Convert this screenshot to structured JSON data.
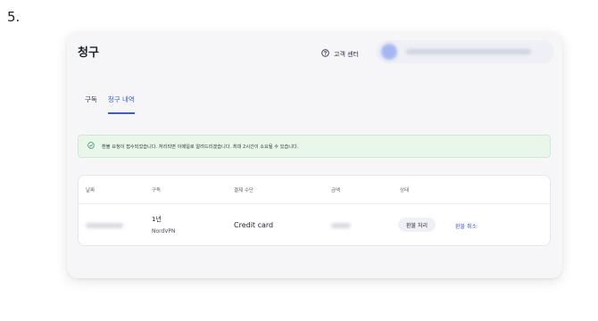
{
  "step_label": "5.",
  "page_title": "청구",
  "header": {
    "support_label": "고객 센터"
  },
  "tabs": [
    {
      "label": "구독",
      "active": false
    },
    {
      "label": "청구 내역",
      "active": true
    }
  ],
  "alert": {
    "message": "환불 요청이 접수되었습니다. 처리되면 이메일로 알려드리겠습니다. 최대 2시간이 소요될 수 있습니다."
  },
  "table": {
    "columns": [
      "날짜",
      "구독",
      "결제 수단",
      "금액",
      "상태"
    ],
    "rows": [
      {
        "subscription_term": "1년",
        "subscription_plan": "NordVPN",
        "payment_method": "Credit card",
        "status": "환불 처리",
        "action": "환불 취소"
      }
    ]
  },
  "colors": {
    "accent": "#3c5bd8",
    "alert_bg": "#e9f6ea",
    "alert_icon": "#2e8b57"
  }
}
